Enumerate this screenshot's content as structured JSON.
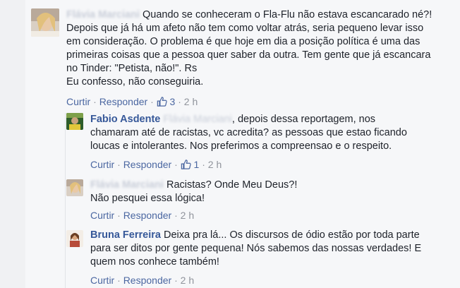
{
  "comments": [
    {
      "author": "Flávia Marciani",
      "text": "Quando se conheceram o Fla-Flu não estava escancarado né?! Depois que já há um afeto não tem como voltar atrás, seria pequeno levar isso em consideração. O problema é que hoje em dia a posição política é uma das primeiras coisas que a pessoa quer saber da outra. Tem gente que já escancara no Tinder: \"Petista, não!\". Rs",
      "text2": "Eu confesso, não conseguiria.",
      "actions": {
        "like": "Curtir",
        "reply": "Responder",
        "likes": "3",
        "time": "2 h"
      }
    },
    {
      "author": "Fabio Asdente",
      "mention": "Flávia Marciani",
      "text": ", depois dessa reportagem, nos chamaram até de racistas, vc acredita? as pessoas que estao ficando loucas e intolerantes. Nos preferimos a compreensao e o respeito.",
      "actions": {
        "like": "Curtir",
        "reply": "Responder",
        "likes": "1",
        "time": "2 h"
      }
    },
    {
      "author": "Flávia Marciani",
      "text": "Racistas? Onde Meu Deus?! Não pesquei essa lógica!",
      "actions": {
        "like": "Curtir",
        "reply": "Responder",
        "time": "2 h"
      }
    },
    {
      "author": "Bruna Ferreira",
      "text": "Deixa pra lá... Os discursos de ódio estão por toda parte para ser ditos por gente pequena! Nós sabemos das nossas verdades! E quem nos conhece também!",
      "actions": {
        "like": "Curtir",
        "reply": "Responder",
        "time": "2 h"
      }
    }
  ],
  "colors": {
    "link": "#4b67a1",
    "author": "#365899",
    "text": "#1d2129",
    "meta": "#90949c"
  }
}
